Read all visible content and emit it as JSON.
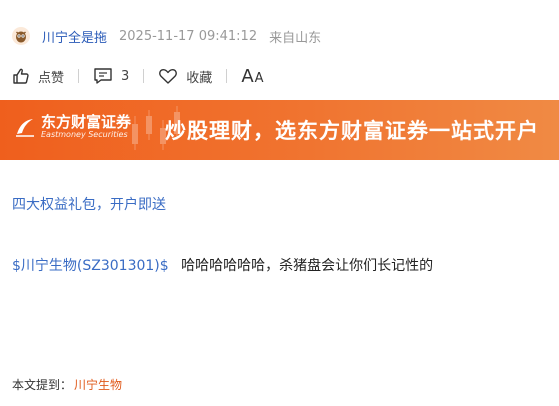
{
  "post": {
    "author": "川宁全是拖",
    "time": "2025-11-17 09:41:12",
    "location": "来自山东"
  },
  "actions": {
    "like_label": "点赞",
    "comment_count": "3",
    "favorite_label": "收藏",
    "font_big": "A",
    "font_small": "A"
  },
  "banner": {
    "brand_cn": "东方财富证券",
    "brand_en": "Eastmoney Securities",
    "slogan": "炒股理财，选东方财富证券一站式开户"
  },
  "promo": {
    "link_text": "四大权益礼包，开户即送"
  },
  "content": {
    "stock_tag": "$川宁生物(SZ301301)$",
    "text": "哈哈哈哈哈哈，杀猪盘会让你们长记性的"
  },
  "mentions": {
    "label": "本文提到：",
    "stock": "川宁生物"
  },
  "colors": {
    "link": "#3a6cc4",
    "banner": "#ef5f1d",
    "mention": "#e05a1b"
  }
}
